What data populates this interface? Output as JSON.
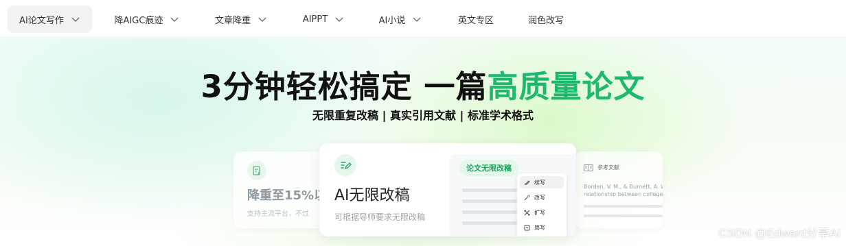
{
  "nav": {
    "items": [
      {
        "label": "AI论文写作",
        "has_dropdown": true,
        "active": true
      },
      {
        "label": "降AIGC痕迹",
        "has_dropdown": true,
        "active": false
      },
      {
        "label": "文章降重",
        "has_dropdown": true,
        "active": false
      },
      {
        "label": "AIPPT",
        "has_dropdown": true,
        "active": false
      },
      {
        "label": "AI小说",
        "has_dropdown": true,
        "active": false
      },
      {
        "label": "英文专区",
        "has_dropdown": false,
        "active": false
      },
      {
        "label": "润色改写",
        "has_dropdown": false,
        "active": false
      }
    ]
  },
  "hero": {
    "title_main": "3分钟轻松搞定 一篇",
    "title_highlight": "高质量论文",
    "subtitle": "无限重复改稿 | 真实引用文献 | 标准学术格式"
  },
  "cards": {
    "left": {
      "title": "降重至15%以",
      "subtitle": "支持主流平台，不过"
    },
    "main": {
      "title": "AI无限改稿",
      "subtitle": "可根据导师要求无限改稿",
      "panel_tag": "论文无限改稿",
      "menu": [
        "续写",
        "改写",
        "扩写",
        "简写"
      ]
    },
    "right": {
      "heading": "参考文献",
      "line1": "Borden, V. M., & Burnett, A. W.",
      "line2": "relationship between college ..."
    }
  },
  "watermark": "CSDN @Edward分享AI",
  "colors": {
    "accent_green": "#1fb86f",
    "tag_bg": "#e3f8e9",
    "nav_active_bg": "#f1f2f4"
  }
}
